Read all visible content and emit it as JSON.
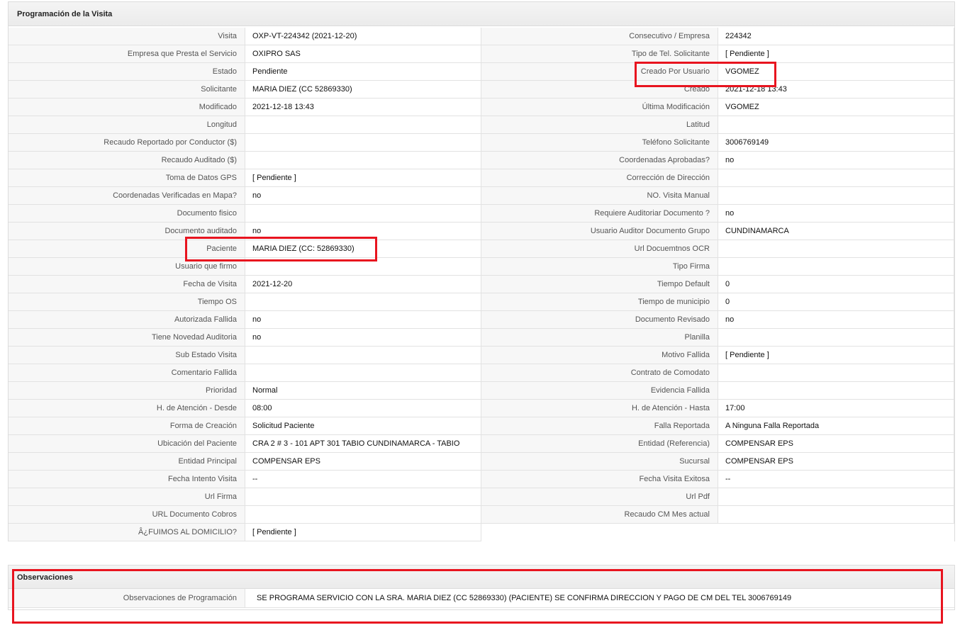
{
  "programacion": {
    "title": "Programación de la Visita",
    "rows": [
      {
        "l1": "Visita",
        "v1": "OXP-VT-224342 (2021-12-20)",
        "l2": "Consecutivo / Empresa",
        "v2": "224342"
      },
      {
        "l1": "Empresa que Presta el Servicio",
        "v1": "OXIPRO SAS",
        "l2": "Tipo de Tel. Solicitante",
        "v2": "[ Pendiente ]"
      },
      {
        "l1": "Estado",
        "v1": "Pendiente",
        "l2": "Creado Por Usuario",
        "v2": "VGOMEZ"
      },
      {
        "l1": "Solicitante",
        "v1": "MARIA DIEZ (CC 52869330)",
        "l2": "Creado",
        "v2": "2021-12-18 13:43"
      },
      {
        "l1": "Modificado",
        "v1": "2021-12-18 13:43",
        "l2": "Última Modificación",
        "v2": " VGOMEZ"
      },
      {
        "l1": "Longitud",
        "v1": "",
        "l2": "Latitud",
        "v2": ""
      },
      {
        "l1": "Recaudo Reportado por Conductor ($)",
        "v1": "",
        "l2": "Teléfono Solicitante",
        "v2": "3006769149"
      },
      {
        "l1": "Recaudo Auditado ($)",
        "v1": "",
        "l2": "Coordenadas Aprobadas?",
        "v2": " no"
      },
      {
        "l1": "Toma de Datos GPS",
        "v1": "[ Pendiente ]",
        "l2": "Corrección de Dirección",
        "v2": ""
      },
      {
        "l1": "Coordenadas Verificadas en Mapa?",
        "v1": " no",
        "l2": "NO. Visita Manual",
        "v2": ""
      },
      {
        "l1": "Documento fisico",
        "v1": "",
        "l2": "Requiere Auditoriar Documento ?",
        "v2": " no"
      },
      {
        "l1": "Documento auditado",
        "v1": " no",
        "l2": "Usuario Auditor Documento Grupo",
        "v2": "CUNDINAMARCA"
      },
      {
        "l1": "Paciente",
        "v1": "MARIA DIEZ (CC: 52869330)",
        "l2": "Url Docuemtnos OCR",
        "v2": ""
      },
      {
        "l1": "Usuario que firmo",
        "v1": "",
        "l2": "Tipo Firma",
        "v2": ""
      },
      {
        "l1": "Fecha de Visita",
        "v1": " 2021-12-20",
        "l2": "Tiempo Default",
        "v2": "0"
      },
      {
        "l1": "Tiempo OS",
        "v1": "",
        "l2": "Tiempo de municipio",
        "v2": "0"
      },
      {
        "l1": "Autorizada Fallida",
        "v1": " no",
        "l2": "Documento Revisado",
        "v2": " no"
      },
      {
        "l1": "Tiene Novedad Auditoria",
        "v1": " no",
        "l2": "Planilla",
        "v2": ""
      },
      {
        "l1": "Sub Estado Visita",
        "v1": "",
        "l2": "Motivo Fallida",
        "v2": "[ Pendiente ]"
      },
      {
        "l1": "Comentario Fallida",
        "v1": "",
        "l2": "Contrato de Comodato",
        "v2": ""
      },
      {
        "l1": "Prioridad",
        "v1": "Normal",
        "l2": "Evidencia Fallida",
        "v2": ""
      },
      {
        "l1": "H. de Atención - Desde",
        "v1": "08:00",
        "l2": "H. de Atención - Hasta",
        "v2": "17:00"
      },
      {
        "l1": "Forma de Creación",
        "v1": "Solicitud Paciente",
        "l2": "Falla Reportada",
        "v2": "A Ninguna Falla Reportada"
      },
      {
        "l1": "Ubicación del Paciente",
        "v1": "CRA 2 # 3 - 101 APT 301 TABIO CUNDINAMARCA - TABIO",
        "l2": "Entidad (Referencia)",
        "v2": "COMPENSAR EPS"
      },
      {
        "l1": "Entidad Principal",
        "v1": "COMPENSAR EPS",
        "l2": "Sucursal",
        "v2": "COMPENSAR EPS"
      },
      {
        "l1": "Fecha Intento Visita",
        "v1": " --",
        "l2": "Fecha Visita Exitosa",
        "v2": " --"
      },
      {
        "l1": "Url Firma",
        "v1": "",
        "l2": "Url Pdf",
        "v2": ""
      },
      {
        "l1": "URL Documento Cobros",
        "v1": "",
        "l2": "Recaudo CM Mes actual",
        "v2": ""
      },
      {
        "l1": "Â¿FUIMOS AL DOMICILIO?",
        "v1": "[ Pendiente ]"
      }
    ]
  },
  "observaciones": {
    "title": "Observaciones",
    "label": "Observaciones de Programación",
    "value": "SE PROGRAMA SERVICIO CON LA SRA. MARIA DIEZ (CC 52869330) (PACIENTE) SE CONFIRMA DIRECCION Y PAGO DE CM DEL TEL 3006769149"
  },
  "colors": {
    "highlight": "#e8141f",
    "label_bg": "#f7f7f7",
    "border": "#e2e2e2"
  }
}
